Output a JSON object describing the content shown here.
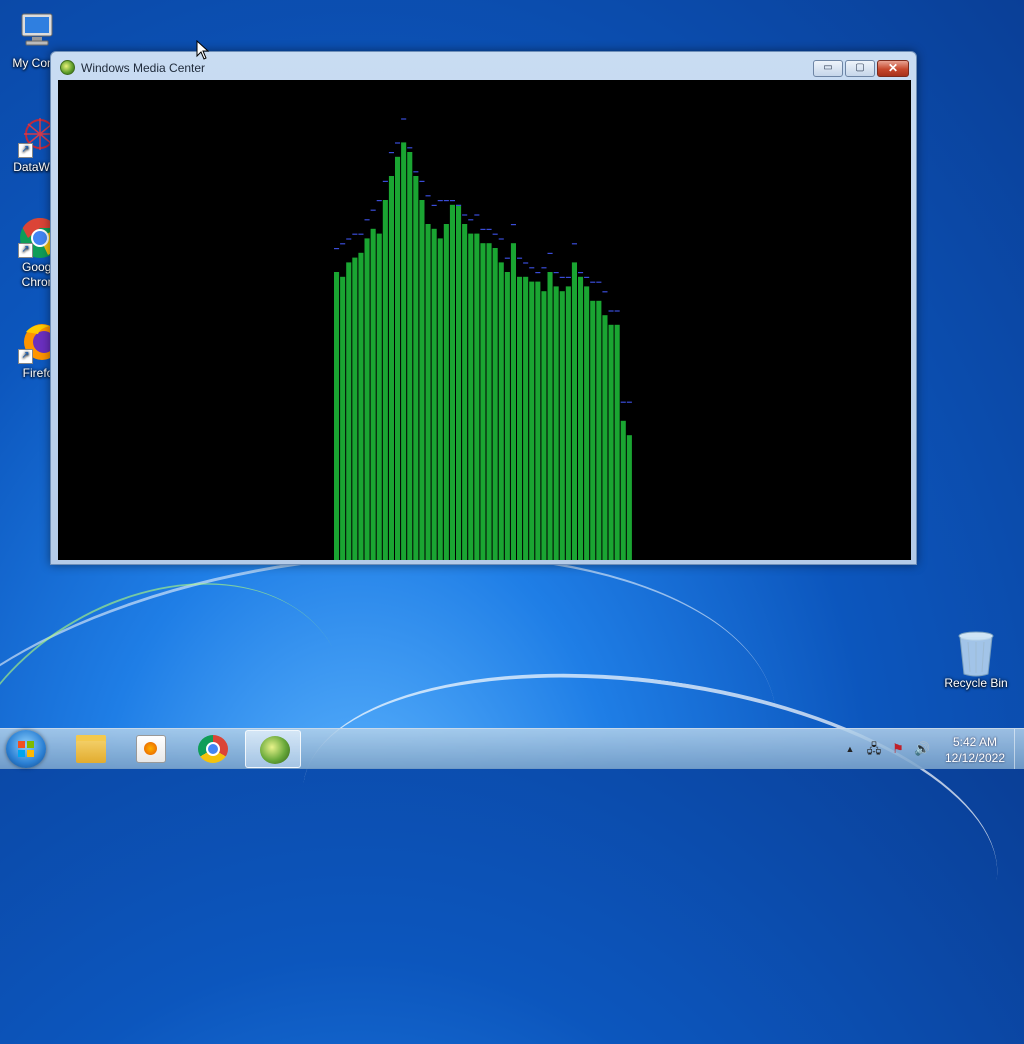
{
  "desktop": {
    "icons": [
      {
        "label": "My Comp",
        "icon": "computer-icon"
      },
      {
        "label": "DataWag",
        "icon": "datawag-icon"
      },
      {
        "label": "Googl\nChron",
        "icon": "chrome-icon"
      },
      {
        "label": "Firefo",
        "icon": "firefox-icon"
      },
      {
        "label": "Recycle Bin",
        "icon": "recycle-bin-icon"
      }
    ]
  },
  "window": {
    "title": "Windows Media Center",
    "buttons": {
      "minimize": "▭",
      "maximize": "▢",
      "close": "✕"
    }
  },
  "visualizer": {
    "bar_color": "#1aa532",
    "peak_color": "#3a4cd8",
    "levels": [
      0.6,
      0.59,
      0.62,
      0.63,
      0.64,
      0.67,
      0.69,
      0.68,
      0.75,
      0.8,
      0.84,
      0.87,
      0.85,
      0.8,
      0.75,
      0.7,
      0.69,
      0.67,
      0.7,
      0.74,
      0.74,
      0.7,
      0.68,
      0.68,
      0.66,
      0.66,
      0.65,
      0.62,
      0.6,
      0.66,
      0.59,
      0.59,
      0.58,
      0.58,
      0.56,
      0.6,
      0.57,
      0.56,
      0.57,
      0.62,
      0.59,
      0.57,
      0.54,
      0.54,
      0.51,
      0.49,
      0.49,
      0.29,
      0.26
    ],
    "peaks": [
      0.65,
      0.66,
      0.67,
      0.68,
      0.68,
      0.71,
      0.73,
      0.75,
      0.79,
      0.85,
      0.87,
      0.92,
      0.86,
      0.81,
      0.79,
      0.76,
      0.74,
      0.75,
      0.75,
      0.75,
      0.74,
      0.72,
      0.71,
      0.72,
      0.69,
      0.69,
      0.68,
      0.67,
      0.63,
      0.7,
      0.63,
      0.62,
      0.61,
      0.6,
      0.61,
      0.64,
      0.6,
      0.59,
      0.59,
      0.66,
      0.6,
      0.59,
      0.58,
      0.58,
      0.56,
      0.52,
      0.52,
      0.33,
      0.33
    ]
  },
  "taskbar": {
    "items": [
      {
        "name": "start-button",
        "icon": "windows-logo-icon"
      },
      {
        "name": "explorer",
        "icon": "folder-icon"
      },
      {
        "name": "media-player",
        "icon": "media-player-icon"
      },
      {
        "name": "chrome",
        "icon": "chrome-icon"
      },
      {
        "name": "media-center",
        "icon": "media-center-icon",
        "active": true
      }
    ],
    "tray": {
      "icons": [
        "show-hidden-icons-icon",
        "network-icon",
        "action-center-icon",
        "volume-icon"
      ],
      "show_hidden": "▲",
      "network": "🖧",
      "action_center": "⚑",
      "volume": "🔊"
    },
    "clock": {
      "time": "5:42 AM",
      "date": "12/12/2022"
    }
  }
}
